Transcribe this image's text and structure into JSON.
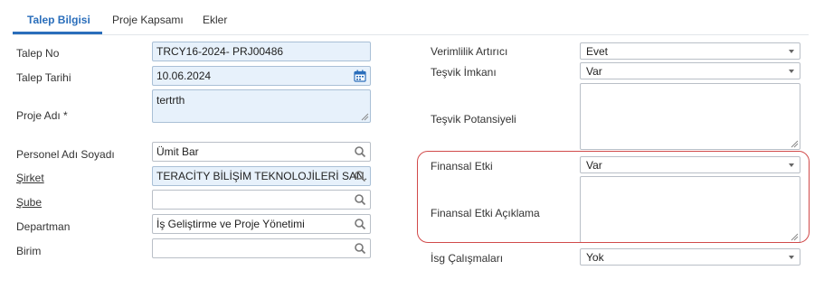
{
  "tabs": [
    "Talep Bilgisi",
    "Proje Kapsamı",
    "Ekler"
  ],
  "left": {
    "talep_no": {
      "label": "Talep No",
      "value": "TRCY16-2024- PRJ00486"
    },
    "talep_tarihi": {
      "label": "Talep Tarihi",
      "value": "10.06.2024"
    },
    "proje_adi": {
      "label": "Proje Adı *",
      "value": "tertrth"
    },
    "personel": {
      "label": "Personel Adı Soyadı",
      "value": "Ümit Bar"
    },
    "sirket": {
      "label": "Şirket",
      "value": "TERACİTY BİLİŞİM TEKNOLOJİLERİ SAN. T"
    },
    "sube": {
      "label": "Şube",
      "value": ""
    },
    "departman": {
      "label": "Departman",
      "value": "İş Geliştirme ve Proje Yönetimi"
    },
    "birim": {
      "label": "Birim",
      "value": ""
    }
  },
  "right": {
    "verimlilik": {
      "label": "Verimlilik Artırıcı",
      "value": "Evet"
    },
    "tesvik_imkani": {
      "label": "Teşvik İmkanı",
      "value": "Var"
    },
    "tesvik_potansiyeli": {
      "label": "Teşvik Potansiyeli",
      "value": ""
    },
    "finansal_etki": {
      "label": "Finansal Etki",
      "value": "Var"
    },
    "finansal_etki_aciklama": {
      "label": "Finansal Etki Açıklama",
      "value": ""
    },
    "isg": {
      "label": "İsg Çalışmaları",
      "value": "Yok"
    }
  },
  "icons": {
    "calendar": "calendar-icon",
    "search": "search-icon",
    "dropdown": "chevron-down-icon"
  },
  "colors": {
    "accent": "#2a6ebb",
    "highlight": "#d14a4a",
    "readonly_bg": "#e7f1fb"
  }
}
